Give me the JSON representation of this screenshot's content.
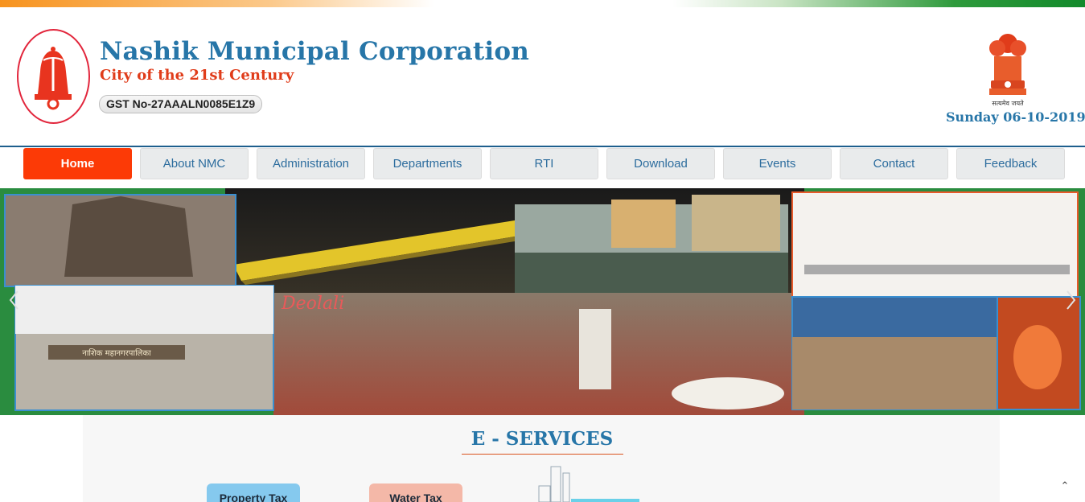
{
  "header": {
    "title": "Nashik Municipal Corporation",
    "tagline": "City of the 21st Century",
    "gst": "GST No-27AAALN0085E1Z9",
    "date": "Sunday 06-10-2019",
    "logo_text": "नाशिक महानगरपालिका",
    "emblem_motto": "सत्यमेव जयते"
  },
  "nav": {
    "items": [
      {
        "label": "Home",
        "active": true
      },
      {
        "label": "About NMC",
        "active": false
      },
      {
        "label": "Administration",
        "active": false
      },
      {
        "label": "Departments",
        "active": false
      },
      {
        "label": "RTI",
        "active": false
      },
      {
        "label": "Download",
        "active": false
      },
      {
        "label": "Events",
        "active": false
      },
      {
        "label": "Contact",
        "active": false
      },
      {
        "label": "Feedback",
        "active": false
      }
    ]
  },
  "banner": {
    "caption": "Deolali",
    "building_sign": "नाशिक महानगरपालिका"
  },
  "eservices": {
    "title": "E - SERVICES",
    "buttons": {
      "property_tax": "Property Tax",
      "water_tax": "Water Tax"
    }
  },
  "colors": {
    "brand_blue": "#2776a8",
    "tagline_red": "#e03c1a",
    "nav_active": "#fc3a06",
    "nav_bg": "#e9ebec"
  },
  "icons": {
    "logo": "nmc-bell-logo",
    "emblem": "ashoka-emblem-icon",
    "prev": "chevron-left-icon",
    "next": "chevron-right-icon",
    "scroll_top": "chevron-up-icon"
  }
}
